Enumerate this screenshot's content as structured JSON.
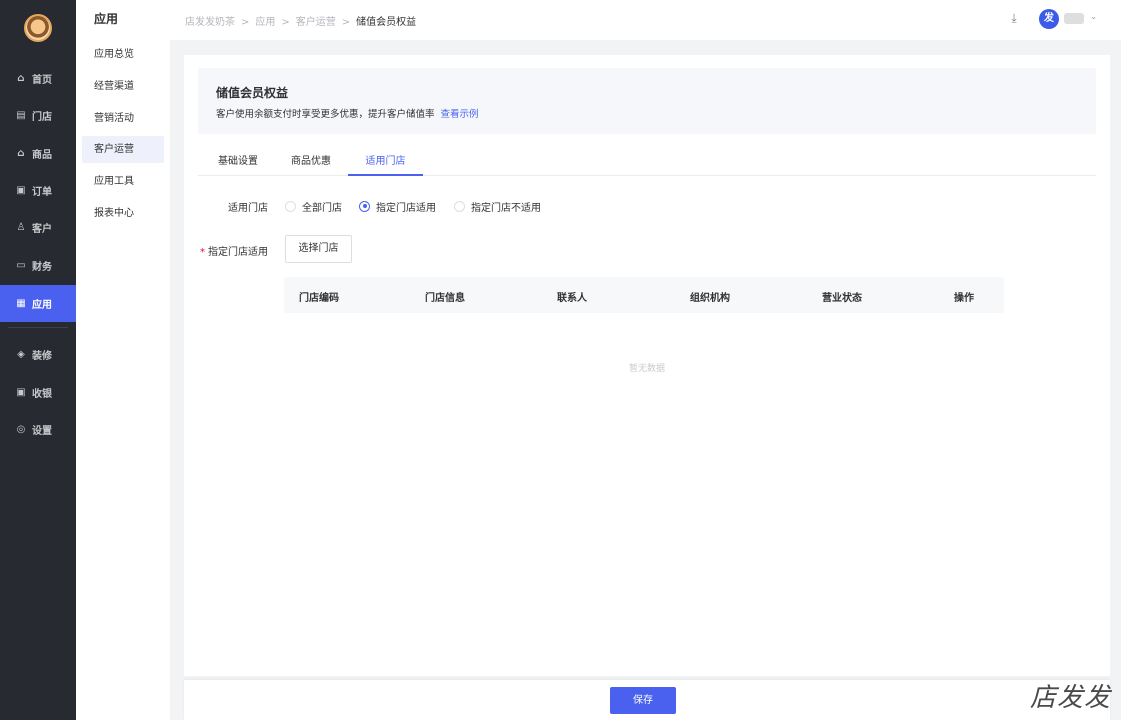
{
  "sidebar": {
    "items": [
      {
        "icon": "home-icon",
        "glyph": "⌂",
        "label": "首页"
      },
      {
        "icon": "store-icon",
        "glyph": "▤",
        "label": "门店"
      },
      {
        "icon": "bag-icon",
        "glyph": "⌂",
        "label": "商品"
      },
      {
        "icon": "order-icon",
        "glyph": "▣",
        "label": "订单"
      },
      {
        "icon": "user-icon",
        "glyph": "♙",
        "label": "客户"
      },
      {
        "icon": "wallet-icon",
        "glyph": "▭",
        "label": "财务"
      },
      {
        "icon": "apps-icon",
        "glyph": "▦",
        "label": "应用",
        "active": true
      },
      {
        "icon": "decor-icon",
        "glyph": "◈",
        "label": "装修"
      },
      {
        "icon": "cashier-icon",
        "glyph": "▣",
        "label": "收银"
      },
      {
        "icon": "settings-icon",
        "glyph": "◎",
        "label": "设置"
      }
    ]
  },
  "subnav": {
    "title": "应用",
    "items": [
      {
        "label": "应用总览"
      },
      {
        "label": "经营渠道"
      },
      {
        "label": "营销活动"
      },
      {
        "label": "客户运营",
        "active": true
      },
      {
        "label": "应用工具"
      },
      {
        "label": "报表中心"
      }
    ]
  },
  "breadcrumb": {
    "items": [
      "店发发奶茶",
      "应用",
      "客户运营"
    ],
    "current": "储值会员权益",
    "sep": ">"
  },
  "header": {
    "avatar_text": "发"
  },
  "banner": {
    "title": "储值会员权益",
    "desc": "客户使用余额支付时享受更多优惠，提升客户储值率",
    "link": "查看示例"
  },
  "tabs": [
    {
      "label": "基础设置"
    },
    {
      "label": "商品优惠"
    },
    {
      "label": "适用门店",
      "active": true
    }
  ],
  "form": {
    "scope_label": "适用门店",
    "options": [
      {
        "label": "全部门店",
        "checked": false
      },
      {
        "label": "指定门店适用",
        "checked": true
      },
      {
        "label": "指定门店不适用",
        "checked": false
      }
    ],
    "specified_label": "指定门店适用",
    "select_button": "选择门店"
  },
  "table": {
    "columns": [
      "门店编码",
      "门店信息",
      "联系人",
      "组织机构",
      "营业状态",
      "操作"
    ],
    "empty_text": "暂无数据"
  },
  "footer": {
    "save": "保存"
  },
  "watermark": "店发发",
  "colors": {
    "primary": "#4a61f0",
    "sidebar": "#272a31"
  }
}
